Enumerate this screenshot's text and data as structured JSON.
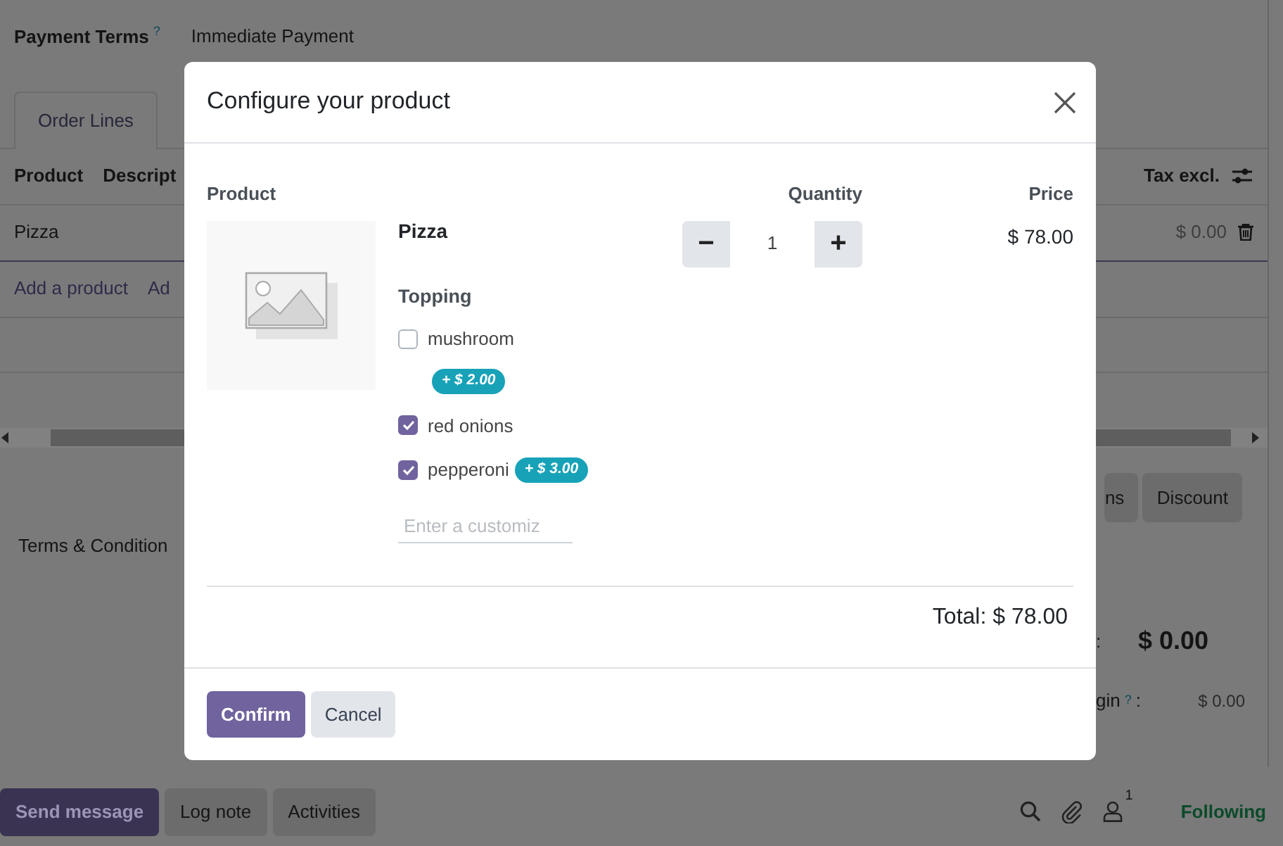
{
  "form": {
    "payment_terms_label": "Payment Terms",
    "payment_terms_help": "?",
    "payment_terms_value": "Immediate Payment"
  },
  "tabs": [
    {
      "label": "Order Lines",
      "selected": true
    }
  ],
  "order_table": {
    "columns": [
      "Product",
      "Descript",
      "Tax excl."
    ],
    "rows": [
      {
        "product": "Pizza",
        "tax_excl": "$ 0.00"
      }
    ],
    "add_links": [
      "Add a product",
      "Ad"
    ]
  },
  "action_buttons": [
    "ns",
    "Discount"
  ],
  "terms_label": "Terms & Condition",
  "totals": [
    {
      "kind": "grand",
      "label": ":",
      "value": "$ 0.00"
    },
    {
      "kind": "line",
      "label": "gin",
      "help": "?",
      "colon": ":",
      "value": "$ 0.00"
    }
  ],
  "chatter": {
    "buttons": [
      {
        "label": "Send message",
        "kind": "primary"
      },
      {
        "label": "Log note",
        "kind": "secondary"
      },
      {
        "label": "Activities",
        "kind": "secondary"
      }
    ],
    "follower_count": "1",
    "follow_label": "Following"
  },
  "dialog": {
    "title": "Configure your product",
    "headers": {
      "product": "Product",
      "quantity": "Quantity",
      "price": "Price"
    },
    "product_name": "Pizza",
    "quantity": "1",
    "quantity_minus": "−",
    "quantity_plus": "+",
    "price": "$ 78.00",
    "attribute": "Topping",
    "options": [
      {
        "label": "mushroom",
        "checked": false,
        "kind": "stacked",
        "extra": "+ $ 2.00"
      },
      {
        "label": "red onions",
        "checked": true,
        "kind": "plain"
      },
      {
        "label": "pepperoni",
        "checked": true,
        "kind": "inline",
        "extra": "+ $ 3.00"
      }
    ],
    "custom_placeholder": "Enter a customiz",
    "total": "Total: $ 78.00",
    "buttons": [
      {
        "label": "Confirm",
        "kind": "primary"
      },
      {
        "label": "Cancel",
        "kind": "secondary"
      }
    ]
  }
}
